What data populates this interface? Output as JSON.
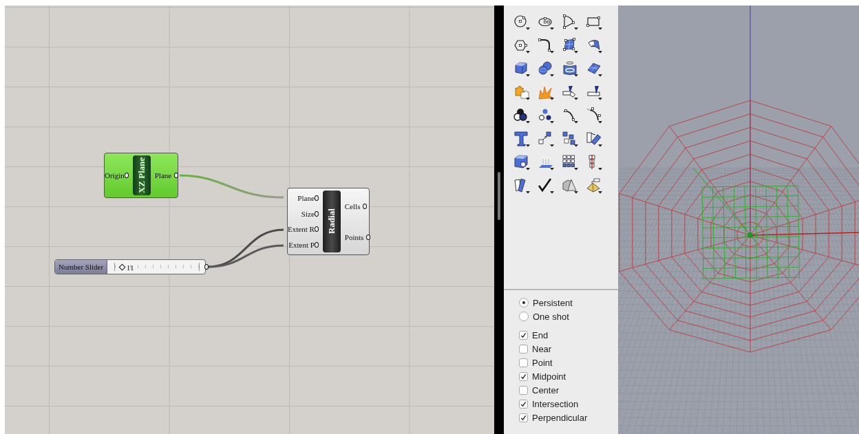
{
  "canvas": {
    "components": [
      {
        "kind": "component",
        "name": "XZ Plane",
        "selected": true,
        "inputs": [
          "Origin"
        ],
        "outputs": [
          "Plane"
        ]
      },
      {
        "kind": "component",
        "name": "Radial",
        "selected": false,
        "inputs": [
          "Plane",
          "Size",
          "Extent R",
          "Extent P"
        ],
        "outputs": [
          "Cells",
          "Points"
        ]
      }
    ],
    "slider": {
      "label": "Number Slider",
      "value": "11",
      "level": 0.08
    }
  },
  "snap_options": {
    "modes": [
      {
        "label": "Persistent",
        "selected": true
      },
      {
        "label": "One shot",
        "selected": false
      }
    ],
    "osnaps": [
      {
        "label": "End",
        "checked": true
      },
      {
        "label": "Near",
        "checked": false
      },
      {
        "label": "Point",
        "checked": false
      },
      {
        "label": "Midpoint",
        "checked": true
      },
      {
        "label": "Center",
        "checked": false
      },
      {
        "label": "Intersection",
        "checked": true
      },
      {
        "label": "Perpendicular",
        "checked": true
      }
    ]
  }
}
